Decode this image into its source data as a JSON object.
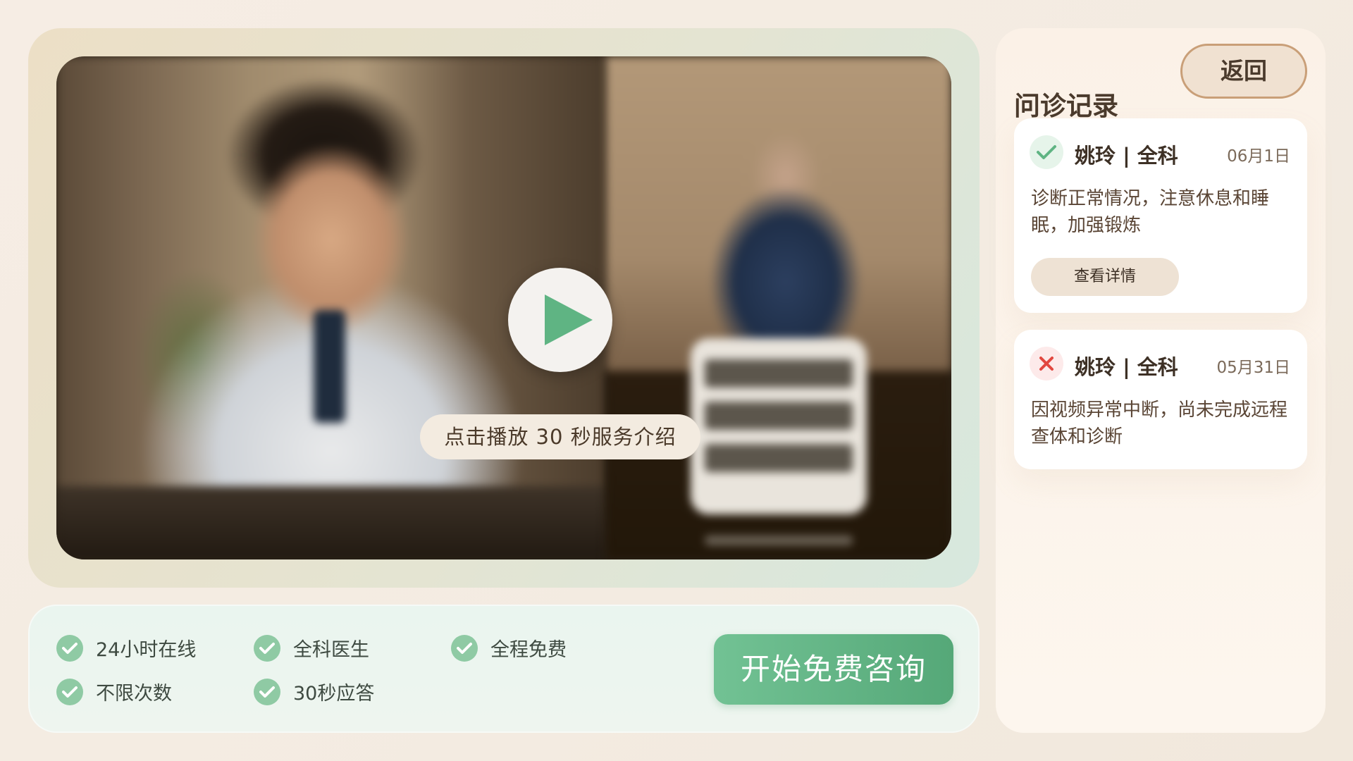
{
  "video": {
    "caption": "点击播放 30 秒服务介绍"
  },
  "features": {
    "items": [
      "24小时在线",
      "全科医生",
      "全程免费",
      "不限次数",
      "30秒应答"
    ],
    "cta_label": "开始免费咨询"
  },
  "records": {
    "title": "问诊记录",
    "back_label": "返回",
    "cards": [
      {
        "status": "completed",
        "doctor": "姚玲 | 全科",
        "date": "06月1日",
        "description": "诊断正常情况，注意休息和睡眠，加强锻炼",
        "detail_label": "查看详情"
      },
      {
        "status": "failed",
        "doctor": "姚玲 | 全科",
        "date": "05月31日",
        "description": "因视频异常中断，尚未完成远程查体和诊断"
      }
    ]
  },
  "colors": {
    "accent_green": "#5fb483",
    "error_red": "#e2473f",
    "brown_text": "#4a3a2c"
  }
}
